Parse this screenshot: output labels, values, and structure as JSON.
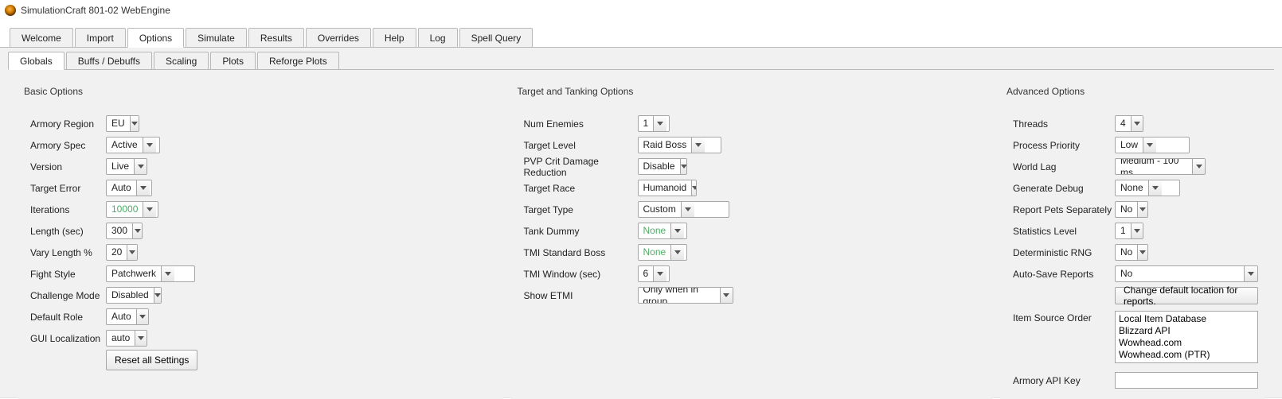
{
  "window": {
    "title": "SimulationCraft 801-02 WebEngine"
  },
  "main_tabs": [
    "Welcome",
    "Import",
    "Options",
    "Simulate",
    "Results",
    "Overrides",
    "Help",
    "Log",
    "Spell Query"
  ],
  "main_tabs_active": 2,
  "sub_tabs": [
    "Globals",
    "Buffs / Debuffs",
    "Scaling",
    "Plots",
    "Reforge Plots"
  ],
  "sub_tabs_active": 0,
  "groups": {
    "basic": {
      "title": "Basic Options",
      "armory_region": {
        "label": "Armory Region",
        "value": "EU"
      },
      "armory_spec": {
        "label": "Armory Spec",
        "value": "Active"
      },
      "version": {
        "label": "Version",
        "value": "Live"
      },
      "target_error": {
        "label": "Target Error",
        "value": "Auto"
      },
      "iterations": {
        "label": "Iterations",
        "value": "10000",
        "disabled": true
      },
      "length": {
        "label": "Length (sec)",
        "value": "300"
      },
      "vary_length": {
        "label": "Vary Length %",
        "value": "20"
      },
      "fight_style": {
        "label": "Fight Style",
        "value": "Patchwerk"
      },
      "challenge_mode": {
        "label": "Challenge Mode",
        "value": "Disabled"
      },
      "default_role": {
        "label": "Default Role",
        "value": "Auto"
      },
      "gui_locale": {
        "label": "GUI Localization",
        "value": "auto"
      },
      "reset_button": "Reset all Settings"
    },
    "target": {
      "title": "Target and Tanking Options",
      "num_enemies": {
        "label": "Num Enemies",
        "value": "1"
      },
      "target_level": {
        "label": "Target Level",
        "value": "Raid Boss"
      },
      "pvp_crit": {
        "label": "PVP Crit Damage Reduction",
        "value": "Disable"
      },
      "target_race": {
        "label": "Target Race",
        "value": "Humanoid"
      },
      "target_type": {
        "label": "Target Type",
        "value": "Custom"
      },
      "tank_dummy": {
        "label": "Tank Dummy",
        "value": "None",
        "disabled": true
      },
      "tmi_boss": {
        "label": "TMI Standard Boss",
        "value": "None",
        "disabled": true
      },
      "tmi_window": {
        "label": "TMI Window (sec)",
        "value": "6"
      },
      "show_etmi": {
        "label": "Show ETMI",
        "value": "Only when in group"
      }
    },
    "advanced": {
      "title": "Advanced Options",
      "threads": {
        "label": "Threads",
        "value": "4"
      },
      "priority": {
        "label": "Process Priority",
        "value": "Low"
      },
      "world_lag": {
        "label": "World Lag",
        "value": "Medium - 100 ms"
      },
      "gen_debug": {
        "label": "Generate Debug",
        "value": "None"
      },
      "pets_sep": {
        "label": "Report Pets Separately",
        "value": "No"
      },
      "stats_level": {
        "label": "Statistics Level",
        "value": "1"
      },
      "det_rng": {
        "label": "Deterministic RNG",
        "value": "No"
      },
      "autosave": {
        "label": "Auto-Save Reports",
        "value": "No"
      },
      "change_loc_btn": "Change default location for reports.",
      "item_source": {
        "label": "Item Source Order",
        "items": [
          "Local Item Database",
          "Blizzard API",
          "Wowhead.com",
          "Wowhead.com (PTR)"
        ]
      },
      "api_key": {
        "label": "Armory API Key",
        "value": ""
      }
    }
  }
}
